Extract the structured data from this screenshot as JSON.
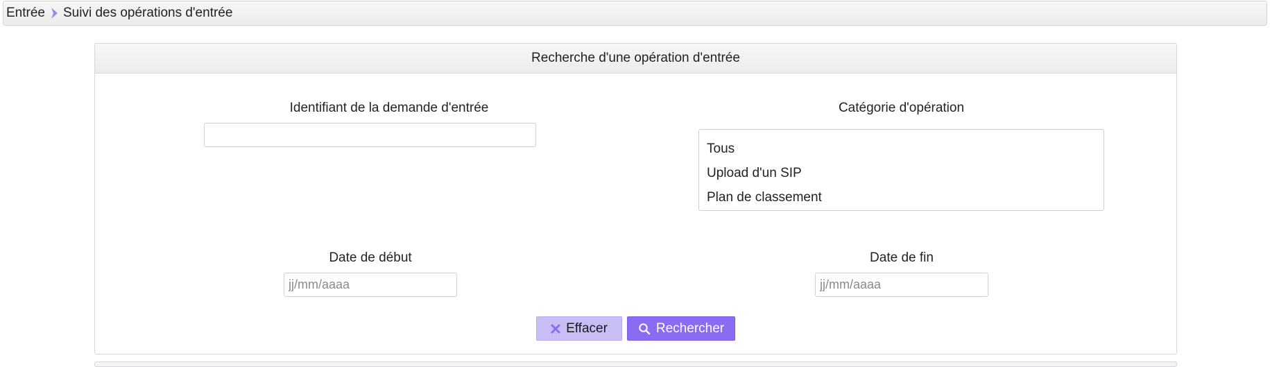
{
  "breadcrumb": {
    "items": [
      "Entrée",
      "Suivi des opérations d'entrée"
    ]
  },
  "search_panel": {
    "title": "Recherche d'une opération d'entrée",
    "request_id_label": "Identifiant de la demande d'entrée",
    "request_id_value": "",
    "category_label": "Catégorie d'opération",
    "category_options": [
      "Tous",
      "Upload d'un SIP",
      "Plan de classement"
    ],
    "start_date_label": "Date de début",
    "start_date_placeholder": "jj/mm/aaaa",
    "end_date_label": "Date de fin",
    "end_date_placeholder": "jj/mm/aaaa",
    "clear_button": "Effacer",
    "search_button": "Rechercher"
  },
  "colors": {
    "accent": "#8a6cf2",
    "accent_light": "#c8bdf5",
    "breadcrumb_chevron": "#9b86f0"
  },
  "icons": {
    "breadcrumb_separator": "chevron-right-icon",
    "clear": "close-icon",
    "search": "search-icon"
  }
}
